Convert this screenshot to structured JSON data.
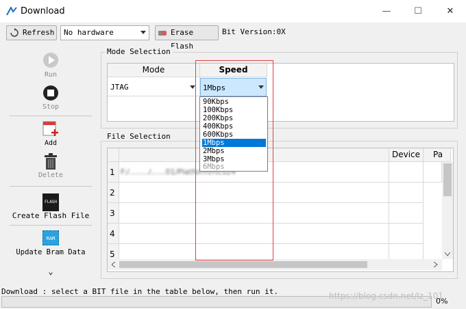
{
  "window": {
    "title": "Download",
    "minimize_glyph": "—",
    "maximize_glyph": "☐",
    "close_glyph": "✕"
  },
  "toolbar": {
    "refresh_label": "Refresh",
    "hardware_select": "No hardware",
    "erase_flash_label": "Erase Flash",
    "bit_version": "Bit Version:0X"
  },
  "sidebar": {
    "run_label": "Run",
    "stop_label": "Stop",
    "add_label": "Add",
    "delete_label": "Delete",
    "create_flash_label": "Create Flash File",
    "update_bram_label": "Update Bram Data",
    "flash_icon_text": "FLASH",
    "ram_icon_text": "RAM",
    "more_glyph": "⌄"
  },
  "mode_selection": {
    "title": "Mode Selection",
    "col_mode": "Mode",
    "col_speed": "Speed",
    "mode_value": "JTAG",
    "speed_value": "1Mbps",
    "speed_options": [
      "90Kbps",
      "100Kbps",
      "200Kbps",
      "400Kbps",
      "600Kbps",
      "1Mbps",
      "2Mbps",
      "3Mbps",
      "6Mbps"
    ],
    "selected_option": "1Mbps"
  },
  "file_selection": {
    "title": "File Selection",
    "col_device": "Device",
    "col_pa": "Pa",
    "row_numbers": [
      "1",
      "2",
      "3",
      "4",
      "5"
    ],
    "row1_path_visible": "F:/......../......01/Platform/rtcs24"
  },
  "status": {
    "message": "Download : select a BIT file in the table below, then run it.",
    "progress": "0%"
  },
  "watermark": "https://blog.csdn.net/lz_101",
  "colors": {
    "accent": "#0078d7",
    "highlight_border": "#e04040",
    "speed_cell": "#cce8ff"
  }
}
